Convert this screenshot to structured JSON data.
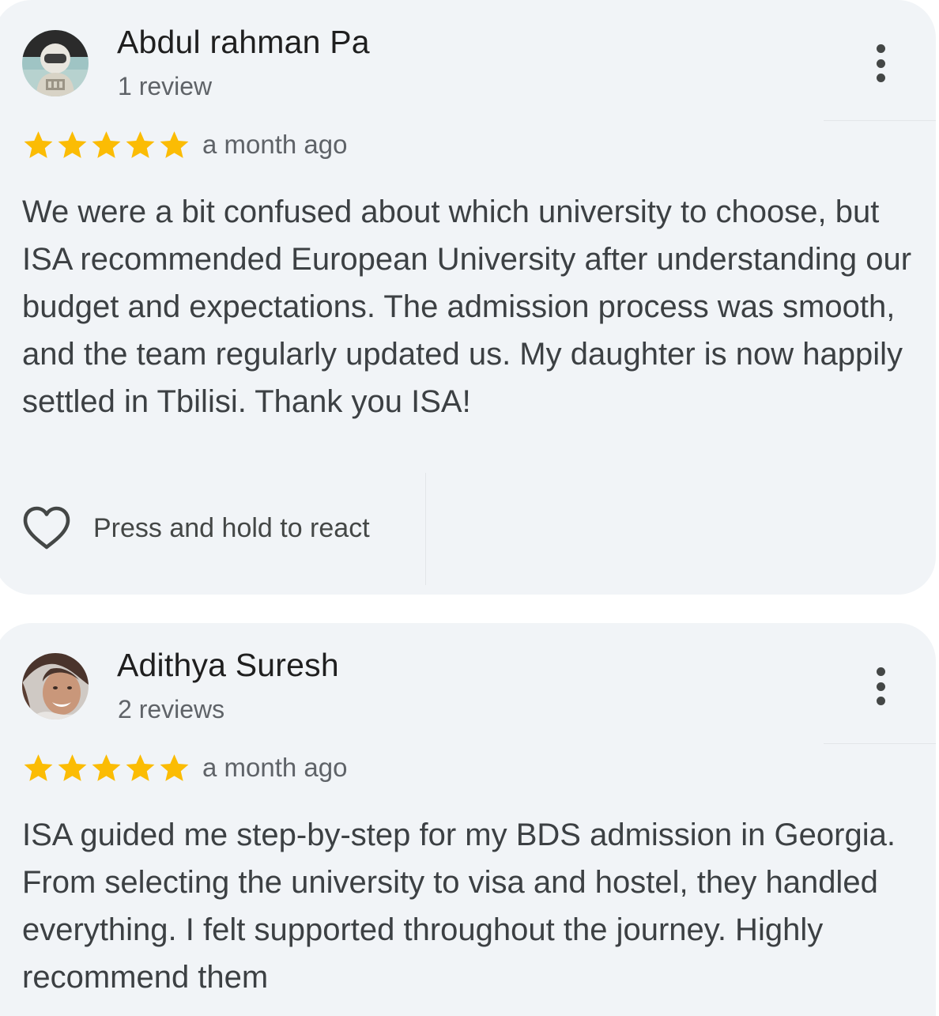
{
  "colors": {
    "card_background": "#f1f4f7",
    "star_filled": "#fbbc04",
    "primary_text": "#1f1f1f",
    "secondary_text": "#5f6368",
    "body_text": "#3c4043"
  },
  "reviews": [
    {
      "author_name": "Abdul rahman Pa",
      "review_count": "1 review",
      "avatar_icon": "astronaut-avatar",
      "rating": 5,
      "rating_max": 5,
      "date": "a month ago",
      "text": "We were a bit confused about which university to choose, but ISA recommended European University after understanding our budget and expectations. The admission process was smooth, and the team regularly updated us. My daughter is now happily settled in Tbilisi. Thank you ISA!",
      "react_label": "Press and hold to react",
      "react_icon": "heart-outline-icon",
      "more_icon": "more-vert-icon"
    },
    {
      "author_name": "Adithya Suresh",
      "review_count": "2 reviews",
      "avatar_icon": "profile-photo-avatar",
      "rating": 5,
      "rating_max": 5,
      "date": "a month ago",
      "text": "ISA guided me step-by-step for my BDS admission in Georgia. From selecting the university to visa and hostel, they handled everything. I felt supported throughout the journey. Highly recommend them",
      "more_icon": "more-vert-icon"
    }
  ]
}
